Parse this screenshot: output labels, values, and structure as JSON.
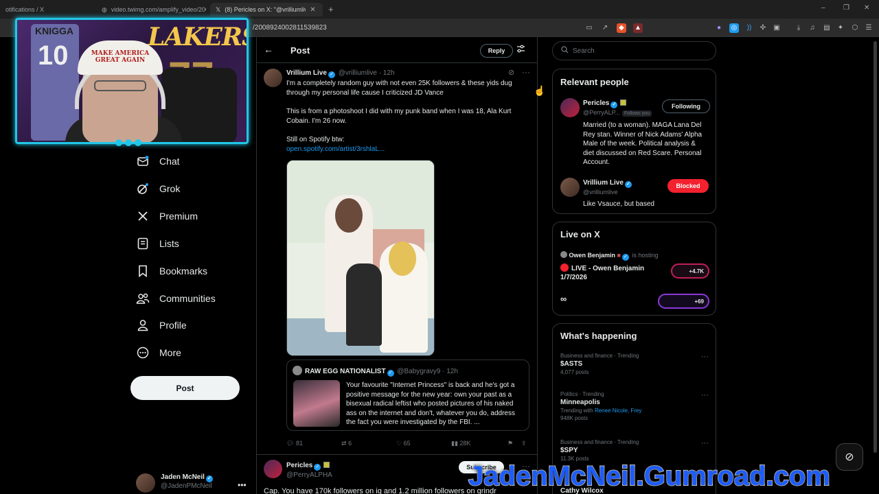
{
  "browser": {
    "tabs": [
      {
        "title": "otifications / X"
      },
      {
        "title": "video.twimg.com/amplify_video/200..."
      },
      {
        "title": "(8) Pericles on X: \"@vrilliumlive C..."
      }
    ],
    "url": "/2008924002811539823",
    "window_controls": [
      "–",
      "❐",
      "✕"
    ]
  },
  "webcam": {
    "jersey_text": "KNIGGA",
    "jersey_number": "10",
    "banner_text": "LAKERS",
    "banner_number": "77",
    "hat_text": "MAKE AMERICA GREAT AGAIN"
  },
  "sidebar": {
    "items": [
      {
        "label": "Chat",
        "icon": "chat-icon"
      },
      {
        "label": "Grok",
        "icon": "grok-icon"
      },
      {
        "label": "Premium",
        "icon": "x-logo-icon"
      },
      {
        "label": "Lists",
        "icon": "lists-icon"
      },
      {
        "label": "Bookmarks",
        "icon": "bookmark-icon"
      },
      {
        "label": "Communities",
        "icon": "communities-icon"
      },
      {
        "label": "Profile",
        "icon": "profile-icon"
      },
      {
        "label": "More",
        "icon": "more-icon"
      }
    ],
    "post_button": "Post",
    "account": {
      "name": "Jaden McNeil",
      "handle": "@JadenPMcNeil",
      "more": "•••"
    }
  },
  "header": {
    "title": "Post",
    "back": "←",
    "reply_button": "Reply"
  },
  "tweet": {
    "author": "Vrillium Live",
    "handle": "@vrilliumlive",
    "time": "· 12h",
    "line1": "I'm a completely random guy with not even 25K followers & these yids dug",
    "line2": "through my personal life cause I criticized JD Vance",
    "line3": "This is from a photoshoot I did with my punk band when I was 18, Ala Kurt",
    "line4": "Cobain. I'm 26 now.",
    "line5": "Still on Spotify btw:",
    "link": "open.spotify.com/artist/3rshlaL...",
    "quote": {
      "author": "RAW EGG NATIONALIST",
      "handle": "@Babygravy9 · 12h",
      "l1": "Your favourite \"Internet Princess\" is back and he's got a",
      "l2": "positive message for the new year: own your past as a",
      "l3": "bisexual radical leftist who posted pictures of his naked",
      "l4": "ass on the internet and don't, whatever you do, address",
      "l5": "the fact you were investigated by the FBI.  ..."
    },
    "actions": {
      "replies": "81",
      "reposts": "6",
      "likes": "65",
      "views": "28K"
    }
  },
  "tweet2": {
    "author": "Pericles",
    "handle": "@PerryALPHA",
    "subscribe": "Subscribe",
    "text": "Cap. You have 170k followers on ig and 1.2 million followers on grindr"
  },
  "right": {
    "search_placeholder": "Search",
    "relevant": {
      "title": "Relevant people",
      "p1": {
        "name": "Pericles",
        "handle": "@PerryALP...",
        "follows_you": "Follows you",
        "button": "Following",
        "b1": "Married (to a woman). MAGA Lana Del",
        "b2": "Rey stan. Winner of Nick Adams' Alpha",
        "b3": "Male of the week. Political analysis &",
        "b4": "diet discussed on Red Scare. Personal",
        "b5": "Account."
      },
      "p2": {
        "name": "Vrillium Live",
        "handle": "@vrilliumlive",
        "button": "Blocked",
        "bio": "Like Vsauce, but based"
      }
    },
    "live": {
      "title": "Live on X",
      "host": "Owen Benjamin",
      "hosting": "is hosting",
      "stream_l1": "LIVE - Owen Benjamin",
      "stream_l2": "1/7/2026",
      "viewers1": "+4.7K",
      "viewers2": "+69"
    },
    "happening": {
      "title": "What's happening",
      "trends": [
        {
          "cat": "Business and finance · Trending",
          "title": "$ASTS",
          "sub": "4,077 posts"
        },
        {
          "cat": "Politics · Trending",
          "title": "Minneapolis",
          "sub_prefix": "Trending with ",
          "sub_link": "Renee Nicole, Frey",
          "sub2": "948K posts"
        },
        {
          "cat": "Business and finance · Trending",
          "title": "$SPY",
          "sub": "11.3K posts"
        }
      ],
      "next": "Cathy Wilcox"
    }
  },
  "overlay": {
    "watermark": "JadenMcNeil.Gumroad.com"
  },
  "colors": {
    "accent": "#1d9bf0",
    "blocked": "#f4212e",
    "webcam_border": "#21c7e8",
    "watermark": "#1b5cff"
  }
}
